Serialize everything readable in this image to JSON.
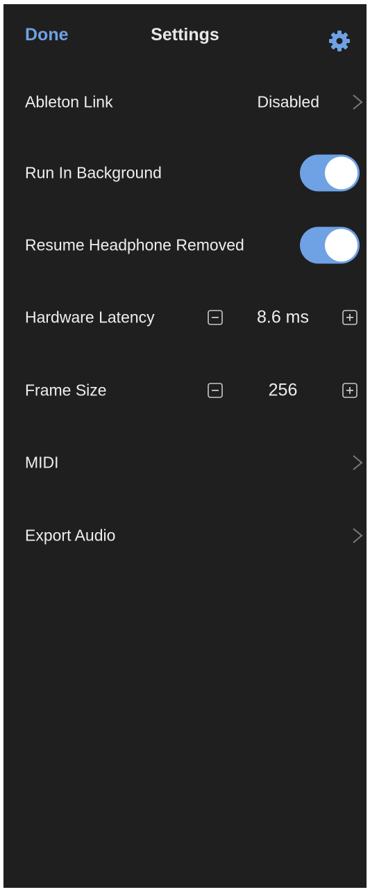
{
  "header": {
    "done_label": "Done",
    "title": "Settings",
    "settings_icon": "gear-icon",
    "accent_color": "#6ea2e4"
  },
  "settings": {
    "ableton_link": {
      "label": "Ableton Link",
      "value": "Disabled"
    },
    "run_in_background": {
      "label": "Run In Background",
      "enabled": true
    },
    "resume_headphone_removed": {
      "label": "Resume Headphone Removed",
      "enabled": true
    },
    "hardware_latency": {
      "label": "Hardware Latency",
      "value": "8.6 ms"
    },
    "frame_size": {
      "label": "Frame Size",
      "value": "256"
    },
    "midi": {
      "label": "MIDI"
    },
    "export_audio": {
      "label": "Export Audio"
    }
  },
  "colors": {
    "background": "#1f1f1f",
    "text": "#eeeeee",
    "toggle_on": "#6ea2e4"
  }
}
